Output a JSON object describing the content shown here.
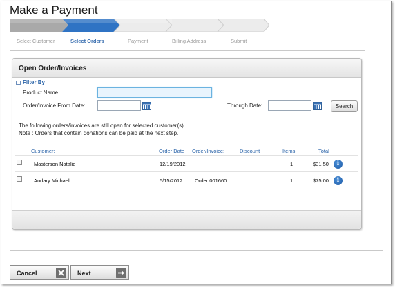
{
  "page": {
    "title": "Make a Payment"
  },
  "wizard": {
    "steps": [
      {
        "label": "Select Customer",
        "state": "done"
      },
      {
        "label": "Select Orders",
        "state": "active"
      },
      {
        "label": "Payment",
        "state": "todo"
      },
      {
        "label": "Billing Address",
        "state": "todo"
      },
      {
        "label": "Submit",
        "state": "todo"
      }
    ],
    "colors": {
      "active": "#2f73c4",
      "done": "#a9a9a9",
      "todo": "#e9e9e9"
    }
  },
  "panel": {
    "title": "Open Order/Invoices",
    "filter": {
      "toggle_label": "Filter By",
      "product_name_label": "Product Name",
      "product_name_value": "",
      "from_date_label": "Order/Invoice From Date:",
      "from_date_value": "",
      "through_date_label": "Through Date:",
      "through_date_value": "",
      "search_label": "Search"
    },
    "notes": [
      "The following orders/invoices are still open for selected customer(s).",
      "Note : Orders that contain donations can be paid at the next step."
    ],
    "table": {
      "columns": [
        "Customer:",
        "Order Date",
        "Order/Invoice:",
        "Discount",
        "Items",
        "Total"
      ],
      "rows": [
        {
          "customer": "Masterson Natalie",
          "order_date": "12/19/2012",
          "order_invoice": "",
          "discount": "",
          "items": "1",
          "total": "$31.50",
          "checked": false
        },
        {
          "customer": "Andary Michael",
          "order_date": "5/15/2012",
          "order_invoice": "Order 001660",
          "discount": "",
          "items": "1",
          "total": "$75.00",
          "checked": false
        }
      ]
    }
  },
  "nav": {
    "cancel_label": "Cancel",
    "next_label": "Next"
  }
}
